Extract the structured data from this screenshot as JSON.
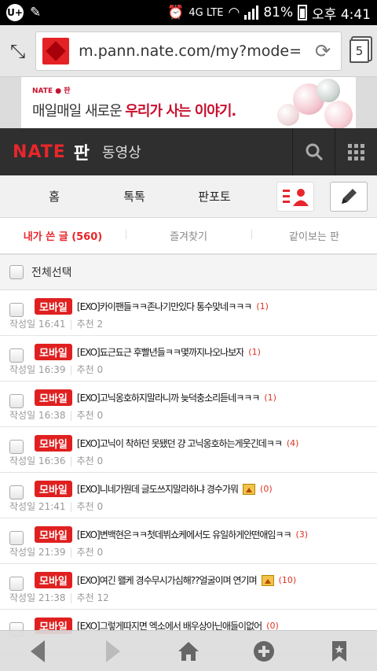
{
  "statusbar": {
    "carrier_icon": "U+",
    "network": "4G LTE",
    "battery": "81%",
    "time": "오후 4:41"
  },
  "browser": {
    "url": "m.pann.nate.com/my?mode=",
    "tab_count": "5"
  },
  "ad": {
    "logo": "NATE ● 판",
    "text_plain": "매일매일 새로운 ",
    "text_highlight": "우리가 사는 이야기."
  },
  "header": {
    "logo_main": "NATE",
    "section": "판",
    "video": "동영상"
  },
  "tabnav": {
    "tabs": [
      "홈",
      "톡톡",
      "판포토"
    ]
  },
  "subtabs": {
    "items": [
      "내가 쓴 글 (560)",
      "즐겨찾기",
      "같이보는 판"
    ]
  },
  "list": {
    "select_all": "전체선택",
    "badge": "모바일",
    "rows": [
      {
        "title": "[EXO]카이팬들ㅋㅋ존나기만있다 통수맞네ㅋㅋㅋ",
        "count": "(1)",
        "date": "작성일 16:41",
        "rec": "추천 2",
        "img": false
      },
      {
        "title": "[EXO]됴근됴근 후빨년들ㅋㅋ몇까지나오나보자",
        "count": "(1)",
        "date": "작성일 16:39",
        "rec": "추천 0",
        "img": false
      },
      {
        "title": "[EXO]고닉옹호하지말라니까 늦덕충소리듣네ㅋㅋㅋ",
        "count": "(1)",
        "date": "작성일 16:38",
        "rec": "추천 0",
        "img": false
      },
      {
        "title": "[EXO]고닉이 착하던 못됐던 걍 고닉옹호하는게웃긴데ㅋㅋ",
        "count": "(4)",
        "date": "작성일 16:36",
        "rec": "추천 0",
        "img": false
      },
      {
        "title": "[EXO]니네가뭔데 글도쓰지말라하냐 경수가뭐",
        "count": "(0)",
        "date": "작성일 21:41",
        "rec": "추천 0",
        "img": true
      },
      {
        "title": "[EXO]변백현은ㅋㅋ첫데뷔쇼케에서도 유일하게안떤애임ㅋㅋ",
        "count": "(3)",
        "date": "작성일 21:39",
        "rec": "추천 0",
        "img": false
      },
      {
        "title": "[EXO]여긴 왤케 경수무시가심해??얼굴이며 연기며",
        "count": "(10)",
        "date": "작성일 21:38",
        "rec": "추천 12",
        "img": true
      },
      {
        "title": "[EXO]그렇게따지면 엑소에서 배우상아닌애들이없어",
        "count": "(0)",
        "date": "",
        "rec": "",
        "img": false
      }
    ]
  },
  "bottomnav": {
    "icons": [
      "back-icon",
      "forward-icon",
      "home-icon",
      "add-icon",
      "bookmark-icon"
    ]
  },
  "colors": {
    "nate_red": "#e8262b",
    "header_bg": "#2f2f2f",
    "badge_red": "#e02020"
  }
}
